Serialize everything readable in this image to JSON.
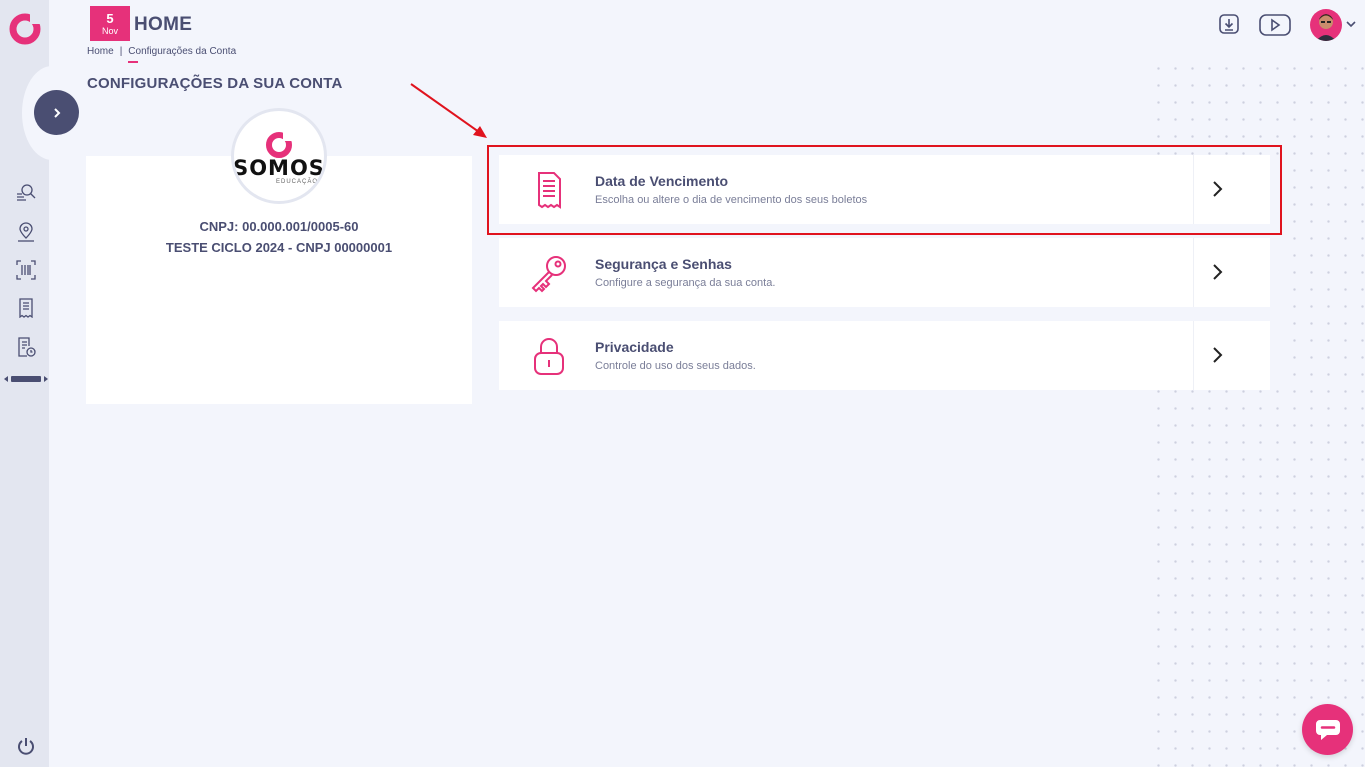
{
  "header": {
    "date_day": "5",
    "date_month": "Nov",
    "title": "HOME",
    "breadcrumb": [
      "Home",
      "Configurações da Conta"
    ],
    "icons": [
      "download-icon",
      "video-icon"
    ]
  },
  "sidebar": {
    "icons": [
      "search-list-icon",
      "location-icon",
      "barcode-icon",
      "receipt-icon",
      "document-clock-icon"
    ]
  },
  "section_title": "CONFIGURAÇÕES DA SUA CONTA",
  "account": {
    "logo_text": "SOMOS",
    "logo_sub": "EDUCAÇÃO",
    "cnpj": "CNPJ: 00.000.001/0005-60",
    "name": "TESTE CICLO 2024 - CNPJ 00000001"
  },
  "menu": [
    {
      "title": "Data de Vencimento",
      "desc": "Escolha ou altere o dia de vencimento dos seus boletos",
      "icon": "receipt-icon"
    },
    {
      "title": "Segurança e Senhas",
      "desc": "Configure a segurança da sua conta.",
      "icon": "key-icon"
    },
    {
      "title": "Privacidade",
      "desc": "Controle do uso dos seus dados.",
      "icon": "lock-icon"
    }
  ],
  "colors": {
    "accent": "#e6317a",
    "text": "#4a4e72",
    "highlight": "#e0131e"
  }
}
